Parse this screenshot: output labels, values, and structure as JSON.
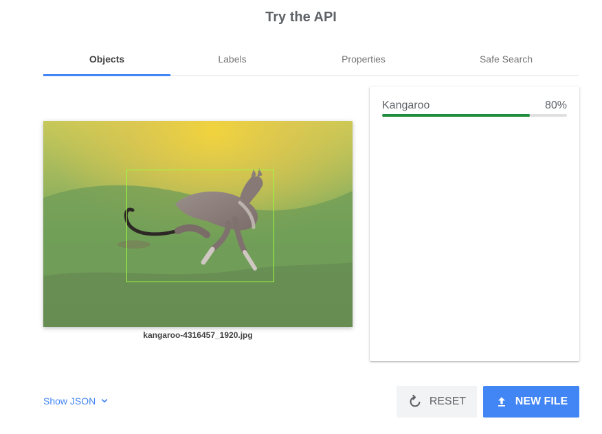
{
  "page": {
    "title": "Try the API"
  },
  "tabs": [
    {
      "label": "Objects",
      "active": true
    },
    {
      "label": "Labels",
      "active": false
    },
    {
      "label": "Properties",
      "active": false
    },
    {
      "label": "Safe Search",
      "active": false
    }
  ],
  "image": {
    "filename": "kangaroo-4316457_1920.jpg",
    "icon": "kangaroo-photo"
  },
  "results": [
    {
      "label": "Kangaroo",
      "score_text": "80%",
      "score": 0.8
    }
  ],
  "footer": {
    "show_json_label": "Show JSON",
    "reset_label": "RESET",
    "new_file_label": "NEW FILE"
  },
  "colors": {
    "accent": "#4285f4",
    "bar_fill": "#1e8e3e",
    "bbox": "#9cff3d"
  }
}
